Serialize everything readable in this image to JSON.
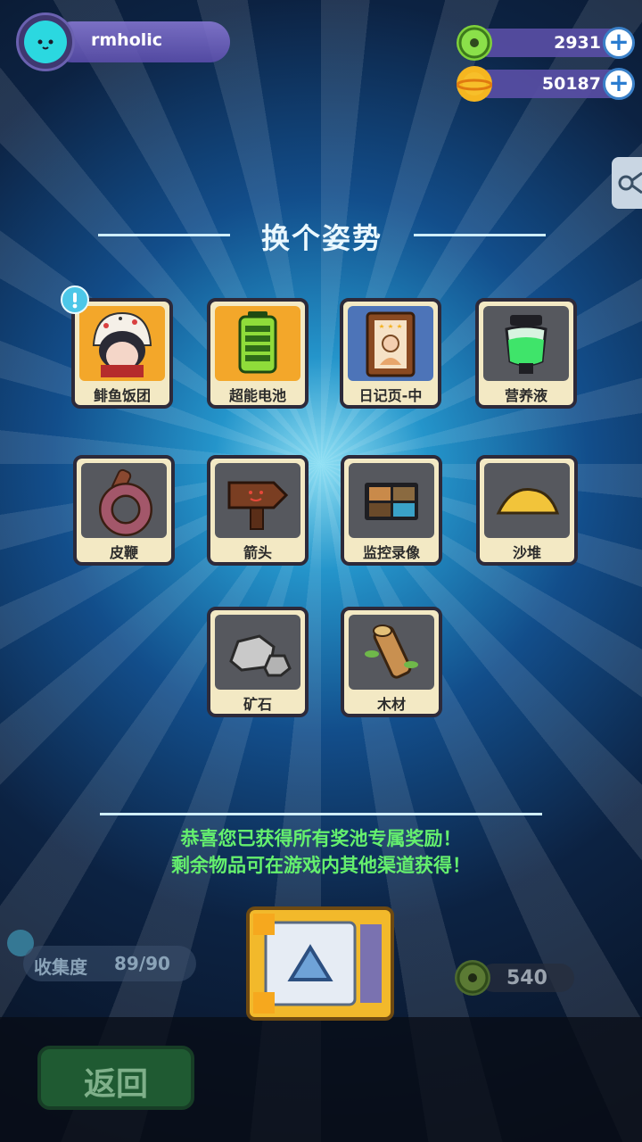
{
  "player": {
    "name": "rmholic"
  },
  "currencies": [
    {
      "icon": "donut-icon",
      "value": "2931",
      "color": "#7fd13b"
    },
    {
      "icon": "planet-coin-icon",
      "value": "50187",
      "color": "#f5b620"
    }
  ],
  "panel": {
    "title": "换个姿势"
  },
  "items": [
    {
      "label": "鲱鱼饭团",
      "icon": "rice-ball-character-icon",
      "new": true
    },
    {
      "label": "超能电池",
      "icon": "battery-icon"
    },
    {
      "label": "日记页-中",
      "icon": "diary-portrait-icon"
    },
    {
      "label": "营养液",
      "icon": "nutrient-jar-icon"
    },
    {
      "label": "皮鞭",
      "icon": "whip-icon"
    },
    {
      "label": "箭头",
      "icon": "arrow-sign-icon"
    },
    {
      "label": "监控录像",
      "icon": "monitor-icon"
    },
    {
      "label": "沙堆",
      "icon": "sand-pile-icon"
    },
    {
      "label": "矿石",
      "icon": "ore-rock-icon"
    },
    {
      "label": "木材",
      "icon": "wood-log-icon"
    }
  ],
  "message": {
    "line1": "恭喜您已获得所有奖池专属奖励！",
    "line2": "剩余物品可在游戏内其他渠道获得！"
  },
  "collection": {
    "label": "收集度",
    "value": "89/90"
  },
  "cost": {
    "value": "540"
  },
  "back": {
    "label": "返回"
  }
}
